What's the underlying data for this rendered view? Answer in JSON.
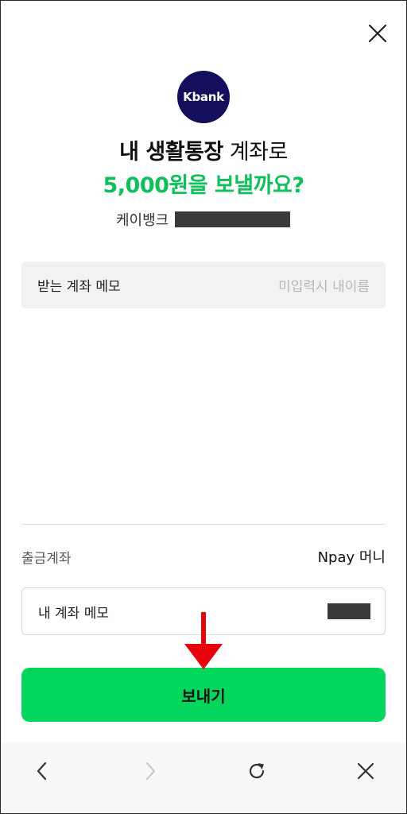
{
  "colors": {
    "brand_green": "#0fbf5c",
    "button_green": "#03d65c",
    "kbank_navy": "#140f5d",
    "arrow_red": "#e8000b"
  },
  "header": {
    "close_icon": "close-icon"
  },
  "bank_logo": {
    "text": "Kbank"
  },
  "confirm": {
    "line1_bold": "내 생활통장",
    "line1_rest": " 계좌로",
    "line2": "5,000원을 보낼까요?",
    "bank_name": "케이뱅크"
  },
  "recipient_memo": {
    "label": "받는 계좌 메모",
    "placeholder": "미입력시 내이름"
  },
  "source_account": {
    "label": "출금계좌",
    "value": "Npay 머니"
  },
  "my_memo": {
    "label": "내 계좌 메모"
  },
  "send_button": {
    "label": "보내기"
  },
  "browser_nav": {
    "icons": [
      "back-icon",
      "forward-icon",
      "refresh-icon",
      "close-icon"
    ]
  }
}
